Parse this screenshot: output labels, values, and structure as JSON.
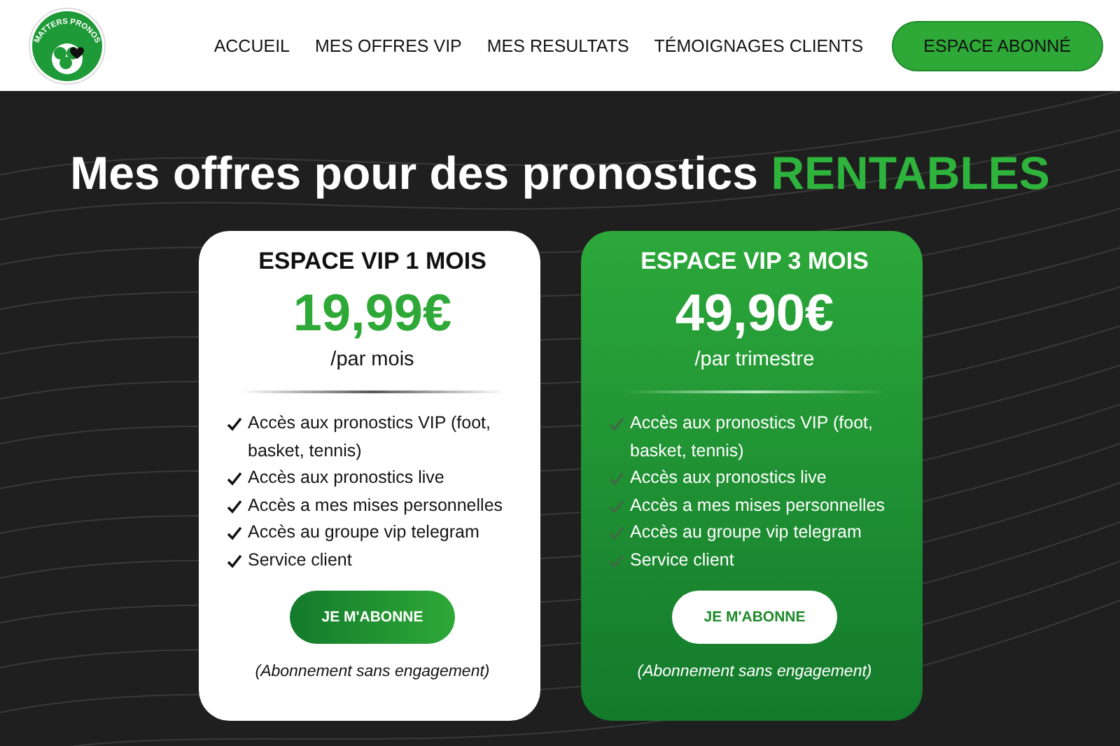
{
  "header": {
    "logo_text": "MATTERS PRONOS",
    "nav": [
      {
        "label": "ACCUEIL"
      },
      {
        "label": "MES OFFRES VIP"
      },
      {
        "label": "MES RESULTATS"
      },
      {
        "label": "TÉMOIGNAGES CLIENTS"
      }
    ],
    "cta": "ESPACE ABONNÉ"
  },
  "hero": {
    "title": "Mes offres pour des pronostics",
    "title_highlight": "RENTABLES"
  },
  "plans": [
    {
      "kind": "light",
      "name": "ESPACE VIP 1 MOIS",
      "price": "19,99€",
      "period": "/par mois",
      "features": [
        "Accès aux pronostics VIP (foot, basket, tennis)",
        "Accès aux pronostics live",
        "Accès a mes mises personnelles",
        "Accès au groupe vip telegram",
        "Service client"
      ],
      "button": "JE M'ABONNE",
      "note": "(Abonnement sans engagement)"
    },
    {
      "kind": "green",
      "name": "ESPACE VIP 3 MOIS",
      "price": "49,90€",
      "period": "/par trimestre",
      "features": [
        "Accès aux pronostics VIP (foot, basket, tennis)",
        "Accès aux pronostics live",
        "Accès a mes mises personnelles",
        "Accès au groupe vip telegram",
        "Service client"
      ],
      "button": "JE M'ABONNE",
      "note": "(Abonnement sans engagement)"
    }
  ]
}
